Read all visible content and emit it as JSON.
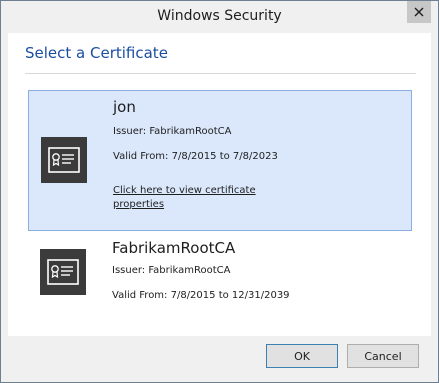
{
  "window": {
    "title": "Windows Security"
  },
  "header": {
    "title": "Select a Certificate"
  },
  "certificates": [
    {
      "name": "jon",
      "issuer": "Issuer: FabrikamRootCA",
      "valid": "Valid From: 7/8/2015 to 7/8/2023",
      "link": "Click here to view certificate properties",
      "selected": true,
      "icon": "certificate-icon"
    },
    {
      "name": "FabrikamRootCA",
      "issuer": "Issuer: FabrikamRootCA",
      "valid": "Valid From: 7/8/2015 to 12/31/2039",
      "selected": false,
      "icon": "certificate-icon"
    }
  ],
  "footer": {
    "ok_label": "OK",
    "cancel_label": "Cancel"
  },
  "colors": {
    "accent": "#1a4fa0",
    "selection": "#dbe8fb",
    "selection_border": "#8aaee0"
  }
}
